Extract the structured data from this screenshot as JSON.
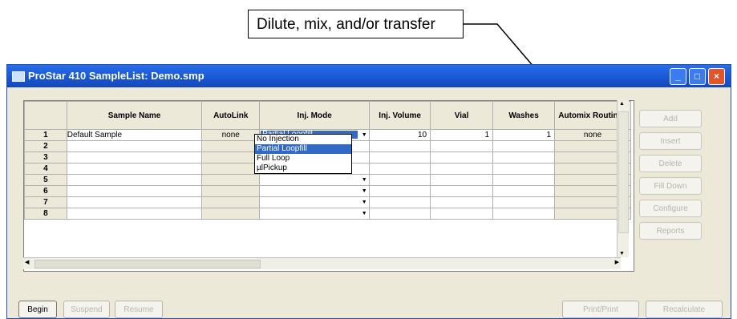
{
  "callout": {
    "text": "Dilute, mix, and/or transfer"
  },
  "window": {
    "title": "ProStar 410 SampleList: Demo.smp"
  },
  "table": {
    "headers": [
      "",
      "Sample Name",
      "AutoLink",
      "Inj. Mode",
      "Inj. Volume",
      "Vial",
      "Washes",
      "Automix Routines"
    ],
    "rows": [
      {
        "num": "1",
        "name": "Default Sample",
        "autolink": "none",
        "mode": "Partial Loopfill",
        "volume": "10",
        "vial": "1",
        "washes": "1",
        "routine": "none"
      },
      {
        "num": "2",
        "name": "",
        "autolink": "",
        "mode": "",
        "volume": "",
        "vial": "",
        "washes": "",
        "routine": ""
      },
      {
        "num": "3",
        "name": "",
        "autolink": "",
        "mode": "",
        "volume": "",
        "vial": "",
        "washes": "",
        "routine": ""
      },
      {
        "num": "4",
        "name": "",
        "autolink": "",
        "mode": "",
        "volume": "",
        "vial": "",
        "washes": "",
        "routine": ""
      },
      {
        "num": "5",
        "name": "",
        "autolink": "",
        "mode": "",
        "volume": "",
        "vial": "",
        "washes": "",
        "routine": ""
      },
      {
        "num": "6",
        "name": "",
        "autolink": "",
        "mode": "",
        "volume": "",
        "vial": "",
        "washes": "",
        "routine": ""
      },
      {
        "num": "7",
        "name": "",
        "autolink": "",
        "mode": "",
        "volume": "",
        "vial": "",
        "washes": "",
        "routine": ""
      },
      {
        "num": "8",
        "name": "",
        "autolink": "",
        "mode": "",
        "volume": "",
        "vial": "",
        "washes": "",
        "routine": ""
      }
    ]
  },
  "dropdown": {
    "options": [
      "No Injection",
      "Partial Loopfill",
      "Full Loop",
      "µlPickup"
    ],
    "selected_index": 1
  },
  "side_buttons": [
    "Add",
    "Insert",
    "Delete",
    "Fill Down",
    "Configure",
    "Reports"
  ],
  "bottom_buttons": [
    "Begin",
    "Suspend",
    "Resume",
    "Print/Print",
    "Recalculate"
  ],
  "icons": {
    "minimize": "minimize-icon",
    "maximize": "maximize-icon",
    "close": "close-icon",
    "dropdown_arrow": "chevron-down-icon"
  }
}
